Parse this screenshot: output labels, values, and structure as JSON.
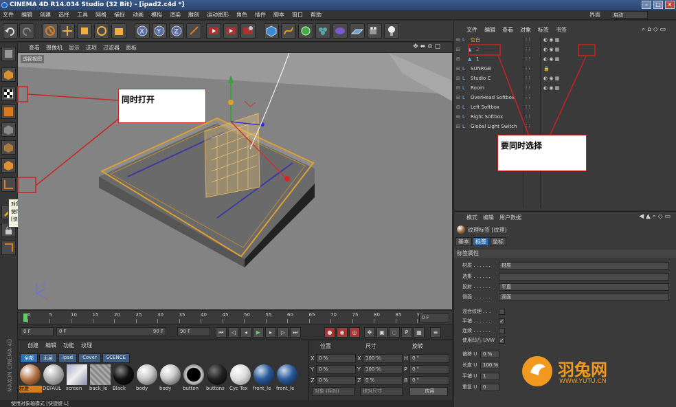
{
  "titlebar": {
    "title": "CINEMA 4D R14.034 Studio (32 Bit) - [ipad2.c4d *]"
  },
  "menubar": {
    "items": [
      "文件",
      "编辑",
      "创建",
      "选择",
      "工具",
      "网格",
      "捕捉",
      "动画",
      "模拟",
      "渲染",
      "雕刻",
      "运动图形",
      "角色",
      "插件",
      "脚本",
      "窗口",
      "帮助"
    ],
    "layout_label": "界面",
    "layout_value": "启动"
  },
  "viewport": {
    "menu": [
      "查看",
      "摄像机",
      "显示",
      "选项",
      "过滤器",
      "面板"
    ],
    "label": "透视视图"
  },
  "timeline": {
    "ticks": [
      "0",
      "5",
      "10",
      "15",
      "20",
      "25",
      "30",
      "35",
      "40",
      "45",
      "50",
      "55",
      "60",
      "65",
      "70",
      "75",
      "80",
      "85",
      "90"
    ],
    "end_field": "0 F"
  },
  "transport": {
    "start": "0 F",
    "current": "0 F",
    "end_left": "90 F",
    "end_right": "90 F"
  },
  "material_panel": {
    "menu": [
      "创建",
      "编辑",
      "功能",
      "纹理"
    ],
    "tabs": [
      "全部",
      "无层",
      "ipad",
      "Cover",
      "SCENCE"
    ],
    "materials": [
      "材质",
      "DEFAUL",
      "screen",
      "back_le",
      "Black",
      "body",
      "body",
      "button",
      "buttons",
      "Cyc Tex",
      "front_le",
      "front_le"
    ]
  },
  "coord_panel": {
    "headers": [
      "位置",
      "尺寸",
      "旋转"
    ],
    "rows": [
      {
        "a": "X",
        "pos": "0 %",
        "b": "X",
        "size": "100 %",
        "c": "H",
        "rot": "0 °"
      },
      {
        "a": "Y",
        "pos": "0 %",
        "b": "Y",
        "size": "100 %",
        "c": "P",
        "rot": "0 °"
      },
      {
        "a": "Z",
        "pos": "0 %",
        "b": "Z",
        "size": "0 %",
        "c": "B",
        "rot": "0 °"
      }
    ],
    "mode1": "对象 (相对)",
    "mode2": "绝对尺寸",
    "apply": "应用"
  },
  "object_manager": {
    "menu": [
      "文件",
      "编辑",
      "查看",
      "对象",
      "标签",
      "书签"
    ],
    "rows": [
      {
        "name": "空白",
        "indent": 0,
        "color": "#e7a53a"
      },
      {
        "name": "2",
        "indent": 2,
        "color": "#e05050"
      },
      {
        "name": "1",
        "indent": 2,
        "color": "#dcdcdc"
      },
      {
        "name": "SUNRGB",
        "indent": 0,
        "color": "#dcdcdc"
      },
      {
        "name": "Studio C",
        "indent": 0,
        "color": "#dcdcdc"
      },
      {
        "name": "Room",
        "indent": 0,
        "color": "#dcdcdc"
      },
      {
        "name": "OverHead Softbox",
        "indent": 0,
        "color": "#dcdcdc"
      },
      {
        "name": "Left Softbox",
        "indent": 0,
        "color": "#dcdcdc"
      },
      {
        "name": "Right Softbox",
        "indent": 0,
        "color": "#dcdcdc"
      },
      {
        "name": "Global Light Switch",
        "indent": 0,
        "color": "#dcdcdc"
      }
    ]
  },
  "attr_manager": {
    "menu": [
      "模式",
      "编辑",
      "用户数据"
    ],
    "title": "纹理标签 [纹理]",
    "tabs": [
      "基本",
      "标签",
      "坐标"
    ],
    "section": "标签属性",
    "rows": [
      {
        "k": "材质 . . . . . .",
        "v": "材质"
      },
      {
        "k": "选集 . . . . . .",
        "v": ""
      },
      {
        "k": "投射 . . . . . .",
        "v": "平直"
      },
      {
        "k": "侧面 . . . . . .",
        "v": "双面"
      }
    ],
    "checks": [
      {
        "k": "混合纹理 . . .",
        "v": ""
      },
      {
        "k": "平铺 . . . . . .",
        "v": "✓"
      },
      {
        "k": "连续 . . . . . .",
        "v": ""
      },
      {
        "k": "使用凹凸 UVW",
        "v": "✓"
      }
    ],
    "uvrows": [
      {
        "k": "偏移 U",
        "v": "0 %"
      },
      {
        "k": "长度 U",
        "v": "100 %"
      },
      {
        "k": "平铺 U",
        "v": "1"
      },
      {
        "k": "重复 U",
        "v": "0"
      }
    ]
  },
  "annotations": {
    "callout1": "同时打开",
    "callout2": "要同时选择"
  },
  "tooltip": {
    "line1": "对象轴",
    "line2": "使用对象轴模式",
    "line3": "[快捷键 L]"
  },
  "statusbar": {
    "text": "使用对象轴模式 [快捷键 L]"
  },
  "watermark": {
    "brand": "羽兔网",
    "url": "WWW.YUTU.CN"
  },
  "maxon": {
    "text": "MAXON CINEMA 4D"
  }
}
